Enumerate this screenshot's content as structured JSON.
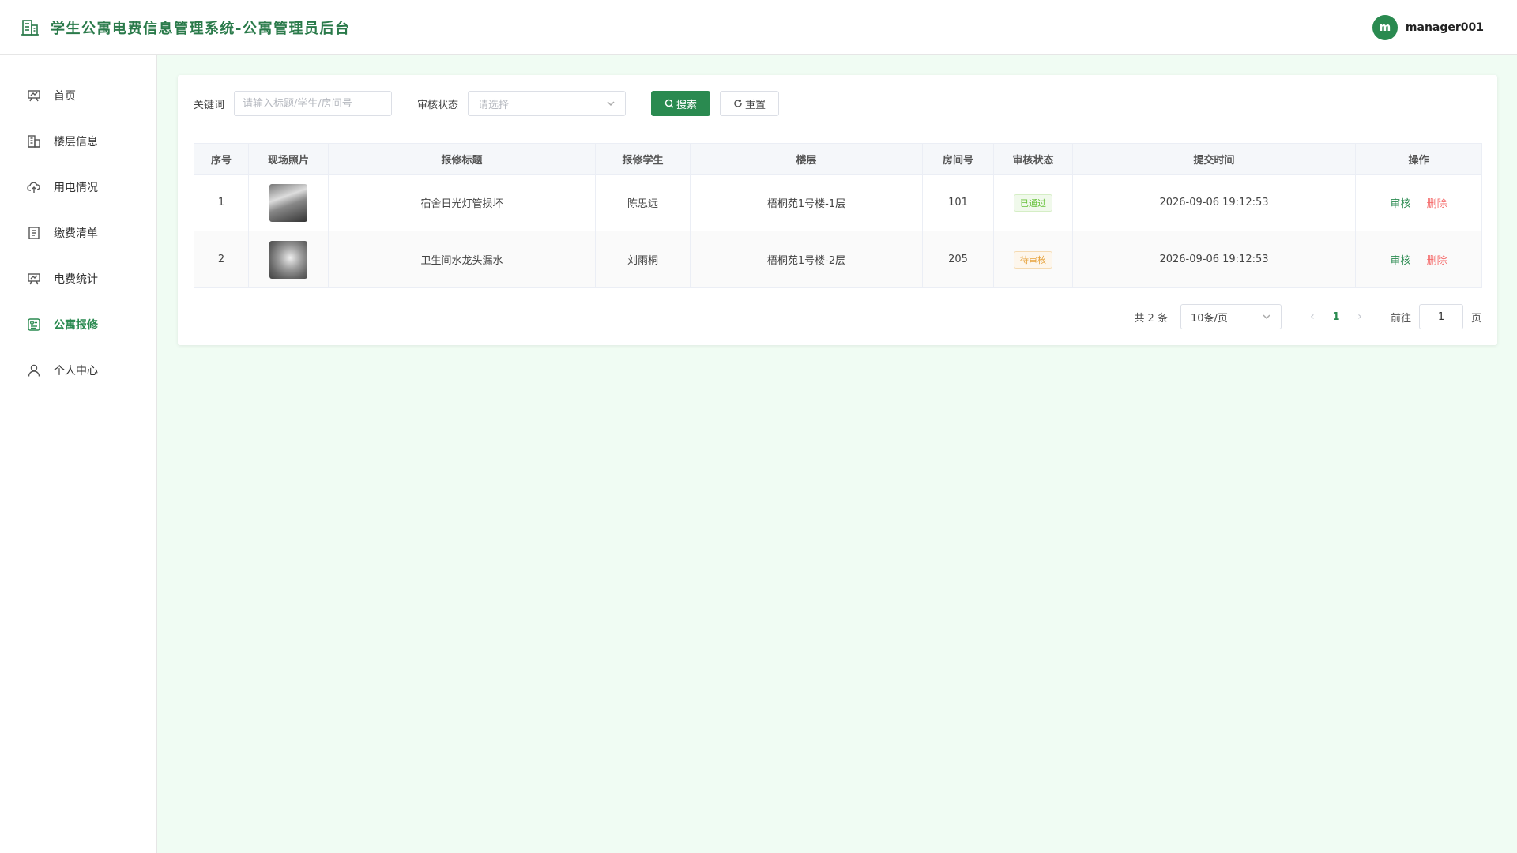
{
  "header": {
    "title": "学生公寓电费信息管理系统-公寓管理员后台",
    "avatar_letter": "m",
    "username": "manager001"
  },
  "sidebar": {
    "items": [
      {
        "label": "首页",
        "icon": "dashboard-icon"
      },
      {
        "label": "楼层信息",
        "icon": "building-icon"
      },
      {
        "label": "用电情况",
        "icon": "cloud-upload-icon"
      },
      {
        "label": "缴费清单",
        "icon": "list-icon"
      },
      {
        "label": "电费统计",
        "icon": "chart-board-icon"
      },
      {
        "label": "公寓报修",
        "icon": "repair-icon",
        "active": true
      },
      {
        "label": "个人中心",
        "icon": "user-icon"
      }
    ]
  },
  "filters": {
    "keyword_label": "关键词",
    "keyword_placeholder": "请输入标题/学生/房间号",
    "status_label": "审核状态",
    "status_placeholder": "请选择",
    "search_label": "搜索",
    "reset_label": "重置"
  },
  "table": {
    "columns": [
      "序号",
      "现场照片",
      "报修标题",
      "报修学生",
      "楼层",
      "房间号",
      "审核状态",
      "提交时间",
      "操作"
    ],
    "rows": [
      {
        "index": "1",
        "title": "宿舍日光灯管损坏",
        "student": "陈思远",
        "floor": "梧桐苑1号楼-1层",
        "room": "101",
        "status": "已通过",
        "time": "2026-09-06 19:12:53"
      },
      {
        "index": "2",
        "title": "卫生间水龙头漏水",
        "student": "刘雨桐",
        "floor": "梧桐苑1号楼-2层",
        "room": "205",
        "status": "待审核",
        "time": "2026-09-06 19:12:53"
      }
    ],
    "audit_label": "审核",
    "delete_label": "删除"
  },
  "pagination": {
    "total": "共 2 条",
    "page_size": "10条/页",
    "current_page": "1",
    "goto_label": "前往",
    "goto_value": "1",
    "page_unit": "页"
  },
  "colors": {
    "primary": "#2a8a50",
    "success": "#67c23a",
    "warning": "#e6a23c",
    "danger": "#f56c6c",
    "background": "#f0fcf3"
  }
}
